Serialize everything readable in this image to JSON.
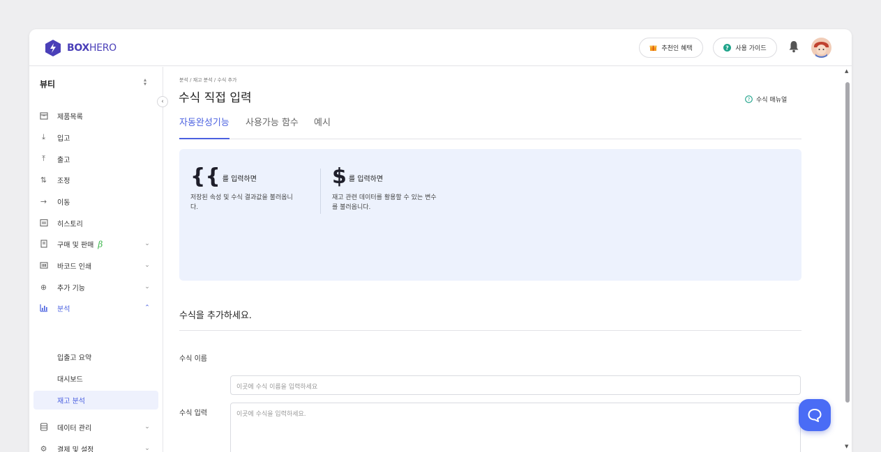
{
  "brand": {
    "name_bold": "BOX",
    "name_light": "HERO",
    "color": "#4a3fb8"
  },
  "header": {
    "referral_label": "추천인 혜택",
    "guide_label": "사용 가이드"
  },
  "sidebar": {
    "workspace": "뷰티",
    "items": [
      {
        "label": "제품목록",
        "icon": "box-icon"
      },
      {
        "label": "입고",
        "icon": "arrow-down-icon"
      },
      {
        "label": "출고",
        "icon": "arrow-up-icon"
      },
      {
        "label": "조정",
        "icon": "arrows-up-down-icon"
      },
      {
        "label": "이동",
        "icon": "arrow-right-icon"
      },
      {
        "label": "히스토리",
        "icon": "history-icon"
      },
      {
        "label": "구매 및 판매",
        "icon": "document-icon",
        "badge": "β"
      },
      {
        "label": "바코드 인쇄",
        "icon": "barcode-icon"
      },
      {
        "label": "추가 기능",
        "icon": "plus-circle-icon"
      },
      {
        "label": "분석",
        "icon": "chart-icon"
      },
      {
        "label": "데이터 관리",
        "icon": "database-icon"
      },
      {
        "label": "결제 및 설정",
        "icon": "settings-icon"
      }
    ],
    "analysis_sub": [
      "입출고 요약",
      "대시보드",
      "재고 분석"
    ]
  },
  "main": {
    "breadcrumb": "분석 / 재고 분석 / 수식 추가",
    "title": "수식 직접 입력",
    "manual_link": "수식 매뉴얼",
    "tabs": [
      "자동완성기능",
      "사용가능 함수",
      "예시"
    ],
    "hints": [
      {
        "symbol": "{{",
        "title": "를 입력하면",
        "desc": "저장된 속성 및 수식 결과값을 불러옵니다."
      },
      {
        "symbol": "$",
        "title": "를 입력하면",
        "desc": "재고 관련 데이터를 활용할 수 있는 변수를 불러옵니다."
      }
    ],
    "section_title": "수식을 추가하세요.",
    "fields": {
      "name_label": "수식 이름",
      "name_placeholder": "이곳에 수식 이름을 입력하세요",
      "formula_label": "수식 입력",
      "formula_placeholder": "이곳에 수식을 입력하세요."
    }
  },
  "colors": {
    "accent": "#4a60e0",
    "panel_bg": "#edf2fd",
    "beta": "#3ab54a",
    "chat": "#4a6cf5"
  }
}
